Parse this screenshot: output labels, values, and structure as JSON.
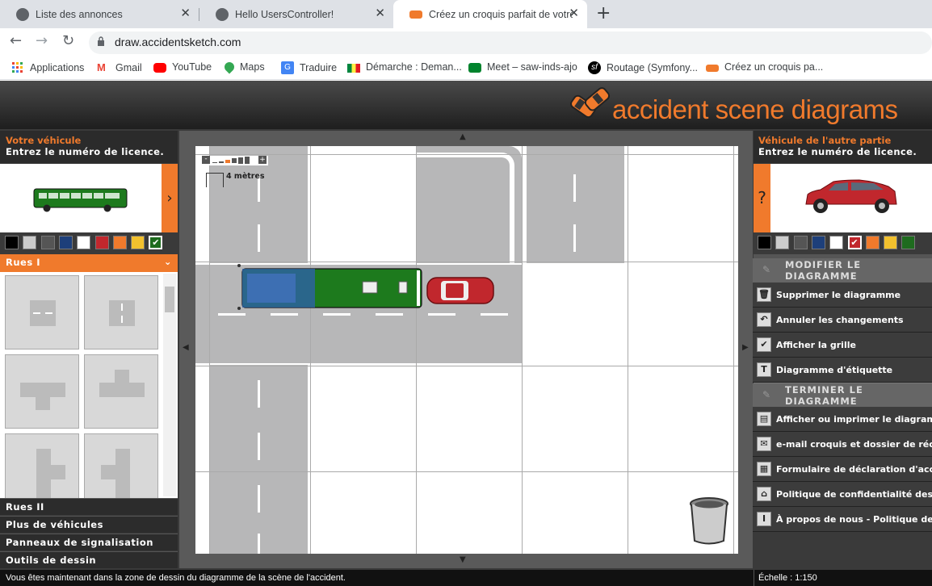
{
  "browser": {
    "tabs": [
      {
        "title": "Liste des annonces",
        "active": false
      },
      {
        "title": "Hello UsersController!",
        "active": false
      },
      {
        "title": "Créez un croquis parfait de votre",
        "active": true
      }
    ],
    "url": "draw.accidentsketch.com",
    "bookmarks": [
      "Applications",
      "Gmail",
      "YouTube",
      "Maps",
      "Traduire",
      "Démarche : Deman...",
      "Meet – saw-inds-ajo",
      "Routage (Symfony...",
      "Créez un croquis pa..."
    ]
  },
  "header": {
    "logo_text": "accident scene diagrams"
  },
  "left_panel": {
    "title": "Votre véhicule",
    "subtitle": "Entrez le numéro de licence.",
    "arrow": "›",
    "colors": [
      "#000000",
      "#cccccc",
      "#555555",
      "#1d3f7a",
      "#ffffff",
      "#c1272d",
      "#f07a2c",
      "#f2c12e",
      "#1e6b1e"
    ],
    "selected_color_index": 8,
    "active_category": "Rues I",
    "categories": [
      "Rues II",
      "Plus de véhicules",
      "Panneaux de signalisation",
      "Outils de dessin"
    ]
  },
  "right_panel": {
    "title": "Véhicule de l'autre partie",
    "subtitle": "Entrez le numéro de licence.",
    "question": "?",
    "colors": [
      "#000000",
      "#cccccc",
      "#555555",
      "#1d3f7a",
      "#ffffff",
      "#c1272d",
      "#f07a2c",
      "#f2c12e",
      "#1e6b1e"
    ],
    "selected_color_index": 5,
    "section_modify": "MODIFIER LE DIAGRAMME",
    "modify_items": [
      "Supprimer le diagramme",
      "Annuler les changements",
      "Afficher la grille",
      "Diagramme d'étiquette"
    ],
    "section_finish": "TERMINER LE DIAGRAMME",
    "finish_items": [
      "Afficher ou imprimer le diagramme",
      "e-mail croquis et dossier de réclamation",
      "Formulaire de déclaration d'accident",
      "Politique de confidentialité des données",
      "À propos de nous - Politique de confidentialité"
    ]
  },
  "canvas": {
    "scale_label": "4 mètres",
    "zoom_minus": "-",
    "zoom_plus": "+"
  },
  "status": {
    "message": "Vous êtes maintenant dans la zone de dessin du diagramme de la scène de l'accident.",
    "scale": "Échelle : 1:150"
  }
}
